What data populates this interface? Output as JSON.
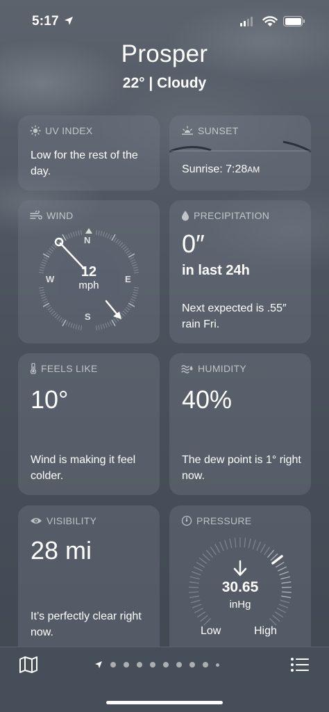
{
  "status_bar": {
    "time": "5:17"
  },
  "header": {
    "city": "Prosper",
    "conditions": "22°  |  Cloudy"
  },
  "cards": {
    "uv": {
      "title": "UV INDEX",
      "text": "Low for the rest of the day."
    },
    "sunset": {
      "title": "SUNSET",
      "sunrise_label": "Sunrise: 7:28",
      "sunrise_suffix": "AM"
    },
    "wind": {
      "title": "WIND",
      "speed": "12",
      "unit": "mph",
      "compass": {
        "n": "N",
        "e": "E",
        "s": "S",
        "w": "W"
      }
    },
    "precipitation": {
      "title": "PRECIPITATION",
      "value": "0″",
      "period": "in last 24h",
      "text": "Next expected is .55″ rain Fri."
    },
    "feels_like": {
      "title": "FEELS LIKE",
      "value": "10°",
      "text": "Wind is making it feel colder."
    },
    "humidity": {
      "title": "HUMIDITY",
      "value": "40%",
      "text": "The dew point is 1° right now."
    },
    "visibility": {
      "title": "VISIBILITY",
      "value": "28 mi",
      "text": "It’s perfectly clear right now."
    },
    "pressure": {
      "title": "PRESSURE",
      "value": "30.65",
      "unit": "inHg",
      "low": "Low",
      "high": "High"
    }
  },
  "tab_bar": {
    "icons": [
      "map-icon",
      "location-arrow-icon",
      "list-icon"
    ],
    "page_dots": 10
  }
}
